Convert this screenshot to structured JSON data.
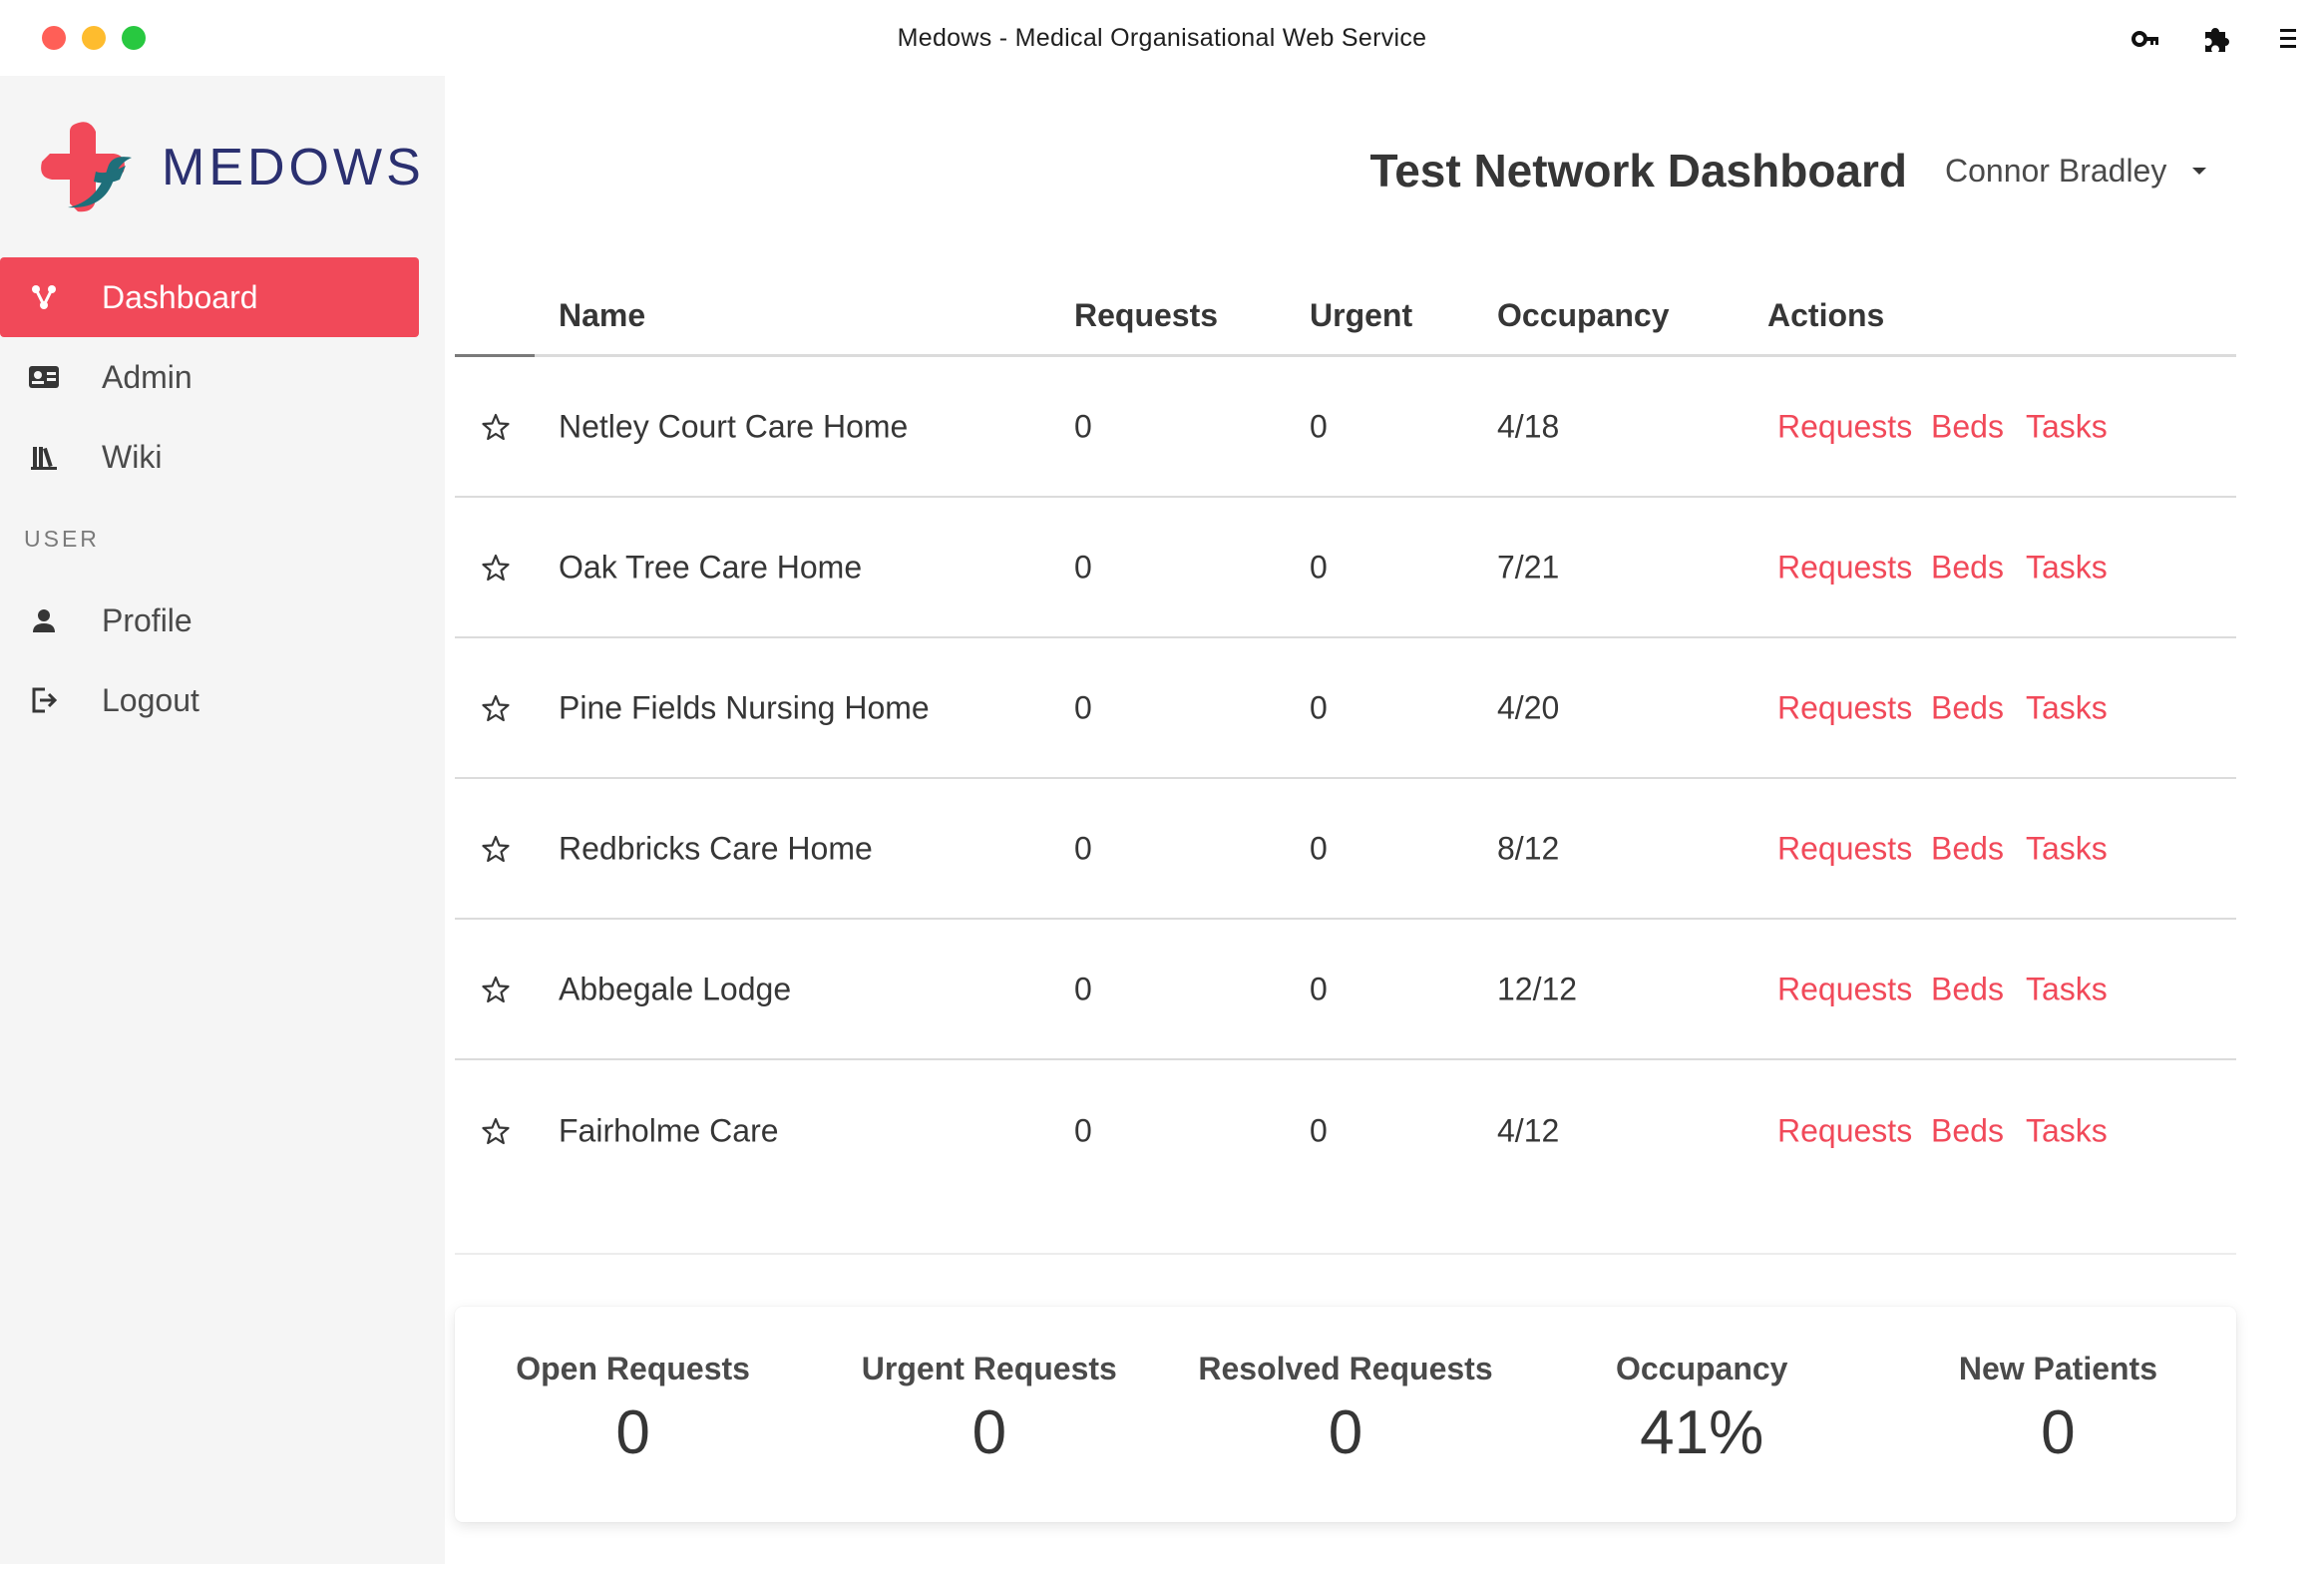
{
  "window": {
    "title": "Medows - Medical Organisational Web Service"
  },
  "titlebar_icons": [
    "key-icon",
    "puzzle-icon",
    "menu-icon"
  ],
  "brand": {
    "name": "MEDOWS",
    "colors": {
      "accent": "#f14959",
      "brand_blue": "#2b3070",
      "brand_teal": "#1f6f7a"
    }
  },
  "sidebar": {
    "items": [
      {
        "label": "Dashboard",
        "icon": "network-icon",
        "active": true
      },
      {
        "label": "Admin",
        "icon": "id-card-icon",
        "active": false
      },
      {
        "label": "Wiki",
        "icon": "books-icon",
        "active": false
      }
    ],
    "user_section_label": "USER",
    "user_items": [
      {
        "label": "Profile",
        "icon": "user-icon"
      },
      {
        "label": "Logout",
        "icon": "logout-icon"
      }
    ]
  },
  "header": {
    "title": "Test Network Dashboard",
    "user_name": "Connor Bradley"
  },
  "table": {
    "columns": [
      "Name",
      "Requests",
      "Urgent",
      "Occupancy",
      "Actions"
    ],
    "rows": [
      {
        "name": "Netley Court Care Home",
        "requests": "0",
        "urgent": "0",
        "occupancy": "4/18"
      },
      {
        "name": "Oak Tree Care Home",
        "requests": "0",
        "urgent": "0",
        "occupancy": "7/21"
      },
      {
        "name": "Pine Fields Nursing Home",
        "requests": "0",
        "urgent": "0",
        "occupancy": "4/20"
      },
      {
        "name": "Redbricks Care Home",
        "requests": "0",
        "urgent": "0",
        "occupancy": "8/12"
      },
      {
        "name": "Abbegale Lodge",
        "requests": "0",
        "urgent": "0",
        "occupancy": "12/12"
      },
      {
        "name": "Fairholme Care",
        "requests": "0",
        "urgent": "0",
        "occupancy": "4/12"
      }
    ],
    "actions": [
      "Requests",
      "Beds",
      "Tasks"
    ]
  },
  "stats": [
    {
      "label": "Open Requests",
      "value": "0"
    },
    {
      "label": "Urgent Requests",
      "value": "0"
    },
    {
      "label": "Resolved Requests",
      "value": "0"
    },
    {
      "label": "Occupancy",
      "value": "41%"
    },
    {
      "label": "New Patients",
      "value": "0"
    }
  ]
}
